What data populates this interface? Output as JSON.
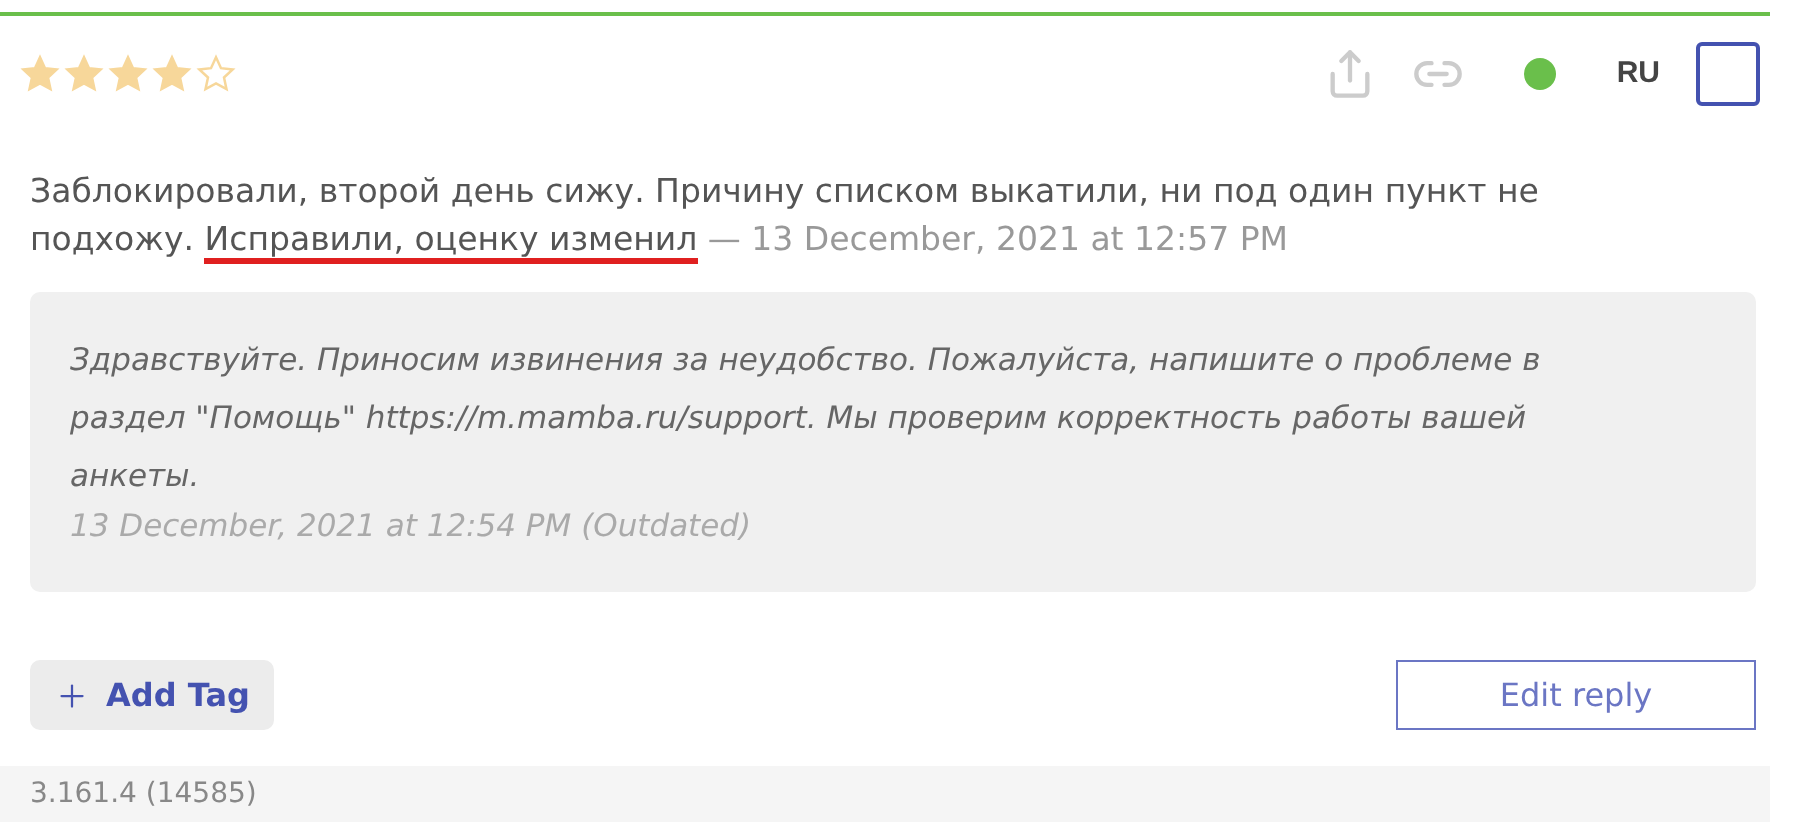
{
  "review": {
    "stars": 4,
    "status": {
      "color": "#6abf4b"
    },
    "language": "RU",
    "checkbox": {
      "checked": false
    },
    "text": "Заблокировали, второй день сижу. Причину списком выкатили, ни под один пункт не подхожу.",
    "edit": {
      "text": "Исправили, оценку изменил",
      "highlighted": true
    },
    "date": "— 13 December, 2021 at 12:57 PM"
  },
  "reply": {
    "text": "Здравствуйте. Приносим извинения за неудобство. Пожалуйста, напишите о проблеме в раздел \"Помощь\" https://m.mamba.ru/support. Мы проверим корректность работы вашей анкеты.",
    "date": "13 December, 2021 at 12:54 PM (Outdated)"
  },
  "buttons": {
    "add_tag": "Add Tag",
    "edit_reply": "Edit reply"
  },
  "version": "3.161.4 (14585)"
}
